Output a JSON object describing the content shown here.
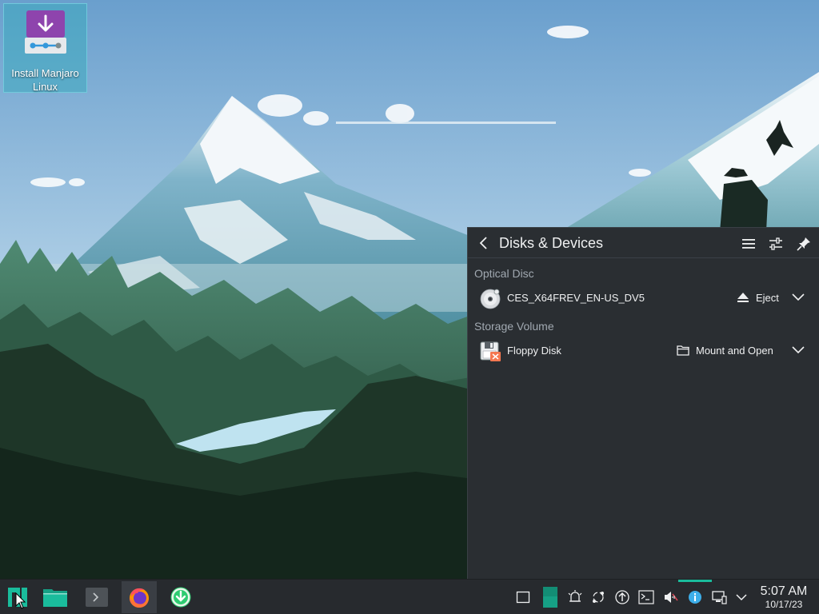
{
  "desktop": {
    "install_icon": {
      "label": "Install Manjaro Linux",
      "icon": "installer-download-icon"
    }
  },
  "popup": {
    "title": "Disks & Devices",
    "sections": [
      {
        "title": "Optical Disc",
        "device": {
          "name": "CES_X64FREV_EN-US_DV5",
          "icon": "optical-disc-icon",
          "action_label": "Eject",
          "action_icon": "eject-icon"
        }
      },
      {
        "title": "Storage Volume",
        "device": {
          "name": "Floppy Disk",
          "icon": "floppy-disk-icon",
          "action_label": "Mount and Open",
          "action_icon": "folder-icon"
        }
      }
    ]
  },
  "taskbar": {
    "launchers": [
      "manjaro-menu-icon",
      "file-manager-icon",
      "terminal-icon",
      "firefox-icon",
      "update-icon"
    ],
    "tray": [
      "show-desktop-icon",
      "virtual-desktop-icon",
      "notifications-icon",
      "kde-connect-icon",
      "update-icon",
      "terminal-icon",
      "volume-muted-icon",
      "info-icon",
      "network-icon",
      "chevron-up-icon"
    ],
    "clock": {
      "time": "5:07 AM",
      "date": "10/17/23"
    }
  },
  "colors": {
    "accent": "#1abc9c",
    "panel_bg": "#2a2e32",
    "taskbar_bg": "#272a2e",
    "install_purple": "#8e44ad",
    "floppy_orange": "#f47750"
  }
}
